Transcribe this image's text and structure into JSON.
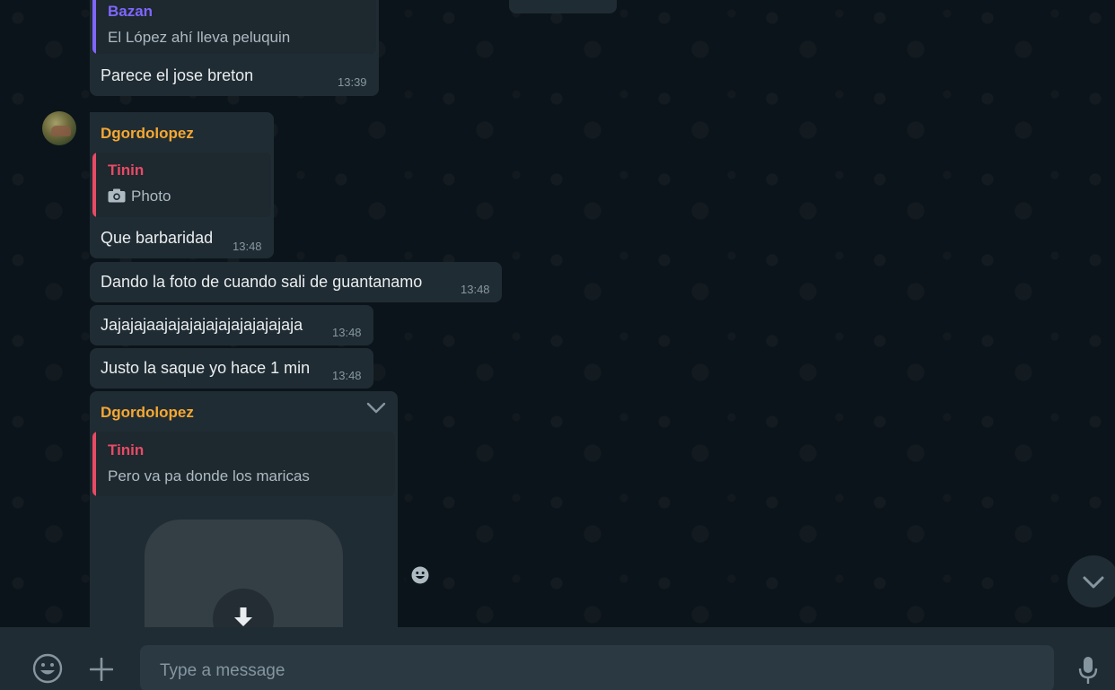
{
  "messages": {
    "m1": {
      "quote_author": "Bazan",
      "quote_text": "El López ahí lleva peluquin",
      "text": "Parece el jose breton",
      "time": "13:39"
    },
    "m2": {
      "sender": "Dgordolopez",
      "quote_author": "Tinin",
      "quote_text": "Photo",
      "text": "Que barbaridad",
      "time": "13:48"
    },
    "m3": {
      "text": "Dando la foto de cuando sali de guantanamo",
      "time": "13:48"
    },
    "m4": {
      "text": "Jajajajaajajajajajajajajajajaja",
      "time": "13:48"
    },
    "m5": {
      "text": "Justo la saque yo hace 1 min",
      "time": "13:48"
    },
    "m6": {
      "sender": "Dgordolopez",
      "quote_author": "Tinin",
      "quote_text": "Pero va pa donde los maricas"
    }
  },
  "composer": {
    "placeholder": "Type a message"
  },
  "icons": {
    "emoji": "emoji-icon",
    "attach": "plus-icon",
    "mic": "microphone-icon",
    "scroll_down": "chevron-down-icon",
    "download": "download-icon",
    "camera": "camera-icon",
    "reaction": "smiley-icon"
  },
  "colors": {
    "sender_orange": "#f6a832",
    "quote_purple": "#7f66ff",
    "quote_red": "#e94a64",
    "bubble": "#202c33",
    "background": "#0b141a"
  }
}
